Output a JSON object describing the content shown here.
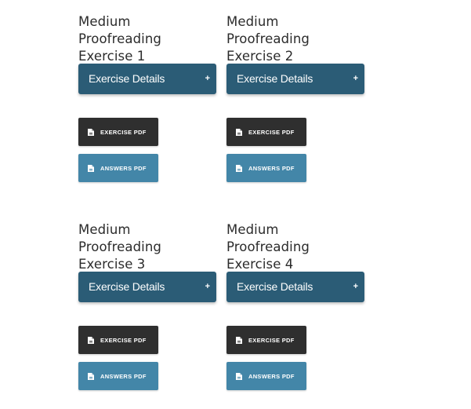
{
  "cards": [
    {
      "title_line1": "Medium Proofreading",
      "title_line2": "Exercise 1",
      "accordion_label": "Exercise Details",
      "accordion_toggle": "+",
      "exercise_pdf_label": "EXERCISE PDF",
      "answers_pdf_label": "ANSWERS PDF"
    },
    {
      "title_line1": "Medium Proofreading",
      "title_line2": "Exercise 2",
      "accordion_label": "Exercise Details",
      "accordion_toggle": "+",
      "exercise_pdf_label": "EXERCISE PDF",
      "answers_pdf_label": "ANSWERS PDF"
    },
    {
      "title_line1": "Medium Proofreading",
      "title_line2": "Exercise 3",
      "accordion_label": "Exercise Details",
      "accordion_toggle": "+",
      "exercise_pdf_label": "EXERCISE PDF",
      "answers_pdf_label": "ANSWERS PDF"
    },
    {
      "title_line1": "Medium Proofreading",
      "title_line2": "Exercise 4",
      "accordion_label": "Exercise Details",
      "accordion_toggle": "+",
      "exercise_pdf_label": "EXERCISE PDF",
      "answers_pdf_label": "ANSWERS PDF"
    }
  ],
  "icons": {
    "file": "file-icon"
  },
  "colors": {
    "accordion_bg": "#2b5c76",
    "exercise_btn_bg": "#2f2f2f",
    "answers_btn_bg": "#4386a8",
    "title_text": "#2b2b2b"
  }
}
